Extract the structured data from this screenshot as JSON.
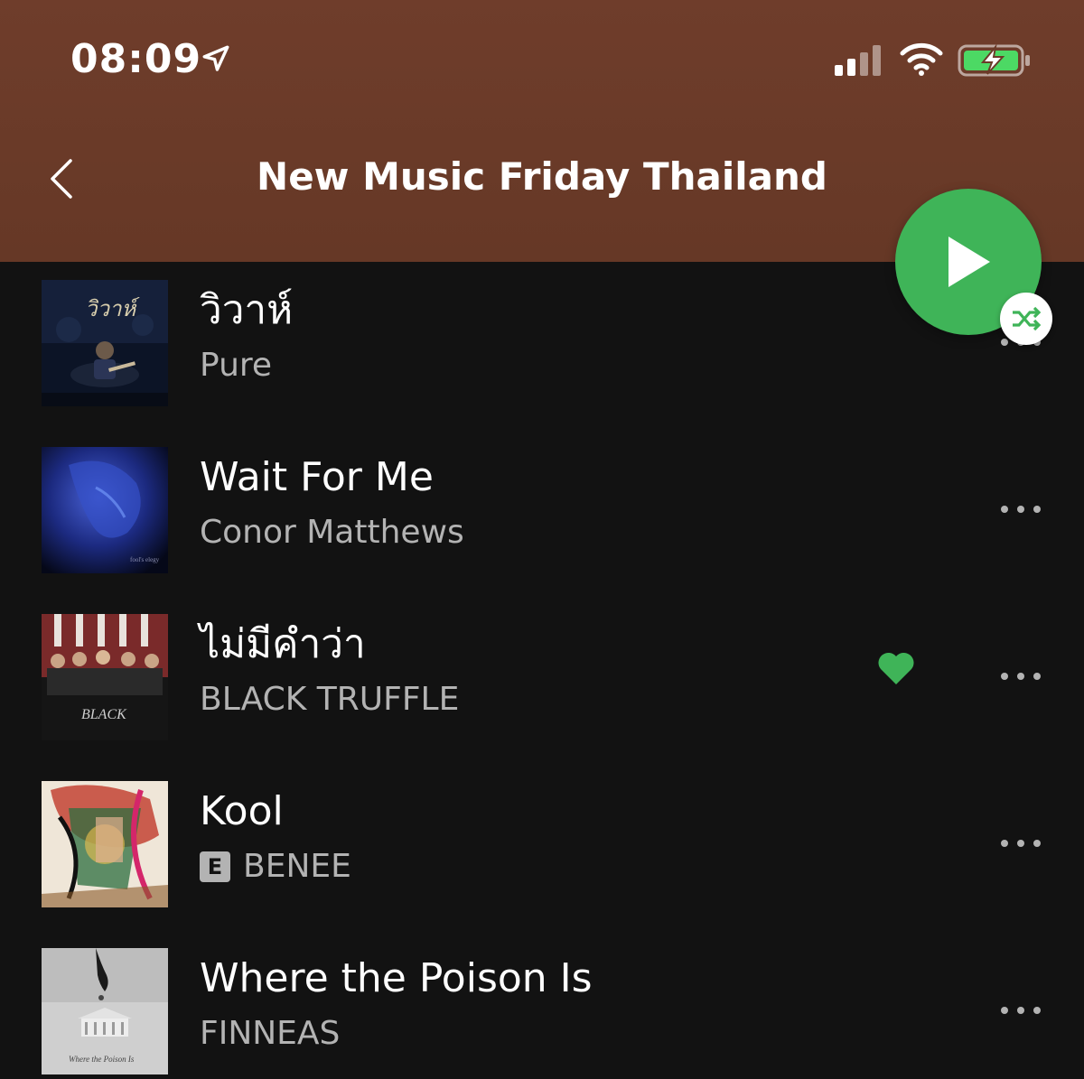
{
  "status_bar": {
    "time": "08:09",
    "location_icon": "location-arrow-icon",
    "signal_icon": "cellular-signal-icon",
    "wifi_icon": "wifi-icon",
    "battery_icon": "battery-charging-icon"
  },
  "header": {
    "title": "New Music Friday Thailand",
    "back_icon": "chevron-left-icon"
  },
  "controls": {
    "play_icon": "play-icon",
    "shuffle_icon": "shuffle-icon"
  },
  "colors": {
    "header_bg": "#6a3a28",
    "list_bg": "#121212",
    "accent_green": "#3fb458",
    "secondary_text": "#b3b3b3"
  },
  "tracks": [
    {
      "title": "วิวาห์",
      "artist": "Pure",
      "explicit": false,
      "liked": false,
      "more_icon": "more-horizontal-icon"
    },
    {
      "title": "Wait For Me",
      "artist": "Conor Matthews",
      "explicit": false,
      "liked": false,
      "more_icon": "more-horizontal-icon"
    },
    {
      "title": "ไม่มีคำว่า",
      "artist": "BLACK TRUFFLE",
      "explicit": false,
      "liked": true,
      "more_icon": "more-horizontal-icon"
    },
    {
      "title": "Kool",
      "artist": "BENEE",
      "explicit": true,
      "explicit_label": "E",
      "liked": false,
      "more_icon": "more-horizontal-icon"
    },
    {
      "title": "Where the Poison Is",
      "artist": "FINNEAS",
      "explicit": false,
      "liked": false,
      "more_icon": "more-horizontal-icon"
    }
  ]
}
